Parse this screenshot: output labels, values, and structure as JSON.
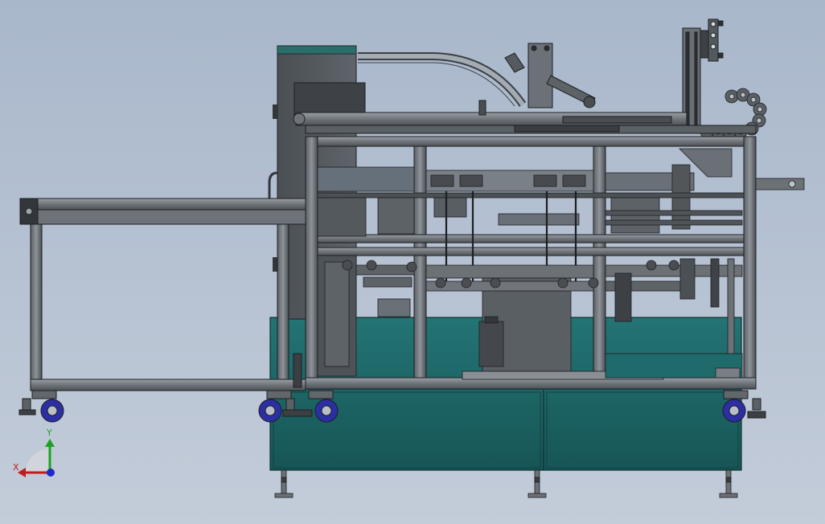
{
  "viewport": {
    "background_top": "#a9b7cb",
    "background_bottom": "#c3ccd9"
  },
  "colors": {
    "frame": "#6e7379",
    "frame_dark": "#3f4347",
    "line": "#1d1f22",
    "teal_panel": "#1f6a6a",
    "teal_panel_dark": "#174f50",
    "cabinet": "#53585d",
    "cabinet_light": "#7b8086",
    "wheel_blue": "#2b2fa3"
  },
  "triad": {
    "x_label": "X",
    "y_label": "Y",
    "x_color": "#c21b1b",
    "y_color": "#19a31e",
    "z_color": "#1c2bd0",
    "icon": "coordinate-triad-icon"
  }
}
